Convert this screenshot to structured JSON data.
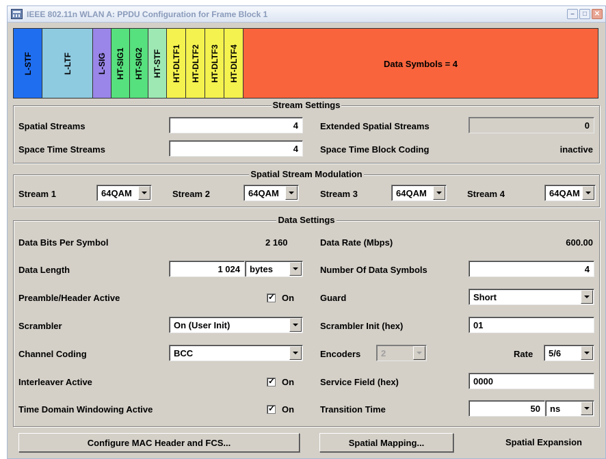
{
  "window": {
    "title": "IEEE 802.11n WLAN  A: PPDU Configuration for Frame Block 1",
    "minimize": "–",
    "maximize": "□",
    "close": "✕"
  },
  "ppdu": {
    "segments": [
      {
        "label": "L-STF",
        "color": "#1f6ef0"
      },
      {
        "label": "L-LTF",
        "color": "#8ecae0"
      },
      {
        "label": "L-SIG",
        "color": "#9a86e8"
      },
      {
        "label": "HT-SIG1",
        "color": "#57e07e"
      },
      {
        "label": "HT-SIG2",
        "color": "#57e07e"
      },
      {
        "label": "HT-STF",
        "color": "#9ee8b4"
      },
      {
        "label": "HT-DLTF1",
        "color": "#f4f24e"
      },
      {
        "label": "HT-DLTF2",
        "color": "#f4f24e"
      },
      {
        "label": "HT-DLTF3",
        "color": "#f4f24e"
      },
      {
        "label": "HT-DLTF4",
        "color": "#f4f24e"
      }
    ],
    "data_label": "Data Symbols = 4",
    "data_color": "#f9643c"
  },
  "stream_settings": {
    "title": "Stream Settings",
    "spatial_streams_label": "Spatial Streams",
    "spatial_streams_value": "4",
    "extended_spatial_streams_label": "Extended Spatial Streams",
    "extended_spatial_streams_value": "0",
    "space_time_streams_label": "Space Time Streams",
    "space_time_streams_value": "4",
    "stbc_label": "Space Time Block Coding",
    "stbc_value": "inactive"
  },
  "modulation": {
    "title": "Spatial Stream Modulation",
    "streams": [
      {
        "label": "Stream 1",
        "value": "64QAM"
      },
      {
        "label": "Stream 2",
        "value": "64QAM"
      },
      {
        "label": "Stream 3",
        "value": "64QAM"
      },
      {
        "label": "Stream 4",
        "value": "64QAM"
      }
    ]
  },
  "data_settings": {
    "title": "Data Settings",
    "bits_per_symbol_label": "Data Bits Per Symbol",
    "bits_per_symbol_value": "2 160",
    "data_rate_label": "Data Rate (Mbps)",
    "data_rate_value": "600.00",
    "data_length_label": "Data Length",
    "data_length_value": "1 024",
    "data_length_unit": "bytes",
    "num_symbols_label": "Number Of Data Symbols",
    "num_symbols_value": "4",
    "preamble_label": "Preamble/Header Active",
    "preamble_state": "On",
    "guard_label": "Guard",
    "guard_value": "Short",
    "scrambler_label": "Scrambler",
    "scrambler_value": "On (User Init)",
    "scrambler_init_label": "Scrambler Init (hex)",
    "scrambler_init_value": "01",
    "channel_coding_label": "Channel Coding",
    "channel_coding_value": "BCC",
    "encoders_label": "Encoders",
    "encoders_value": "2",
    "rate_label": "Rate",
    "rate_value": "5/6",
    "interleaver_label": "Interleaver Active",
    "interleaver_state": "On",
    "service_field_label": "Service Field (hex)",
    "service_field_value": "0000",
    "tdw_label": "Time Domain Windowing Active",
    "tdw_state": "On",
    "transition_time_label": "Transition Time",
    "transition_time_value": "50",
    "transition_time_unit": "ns"
  },
  "footer": {
    "configure_mac_label": "Configure MAC Header and FCS...",
    "spatial_mapping_label": "Spatial Mapping...",
    "spatial_expansion_label": "Spatial Expansion"
  }
}
